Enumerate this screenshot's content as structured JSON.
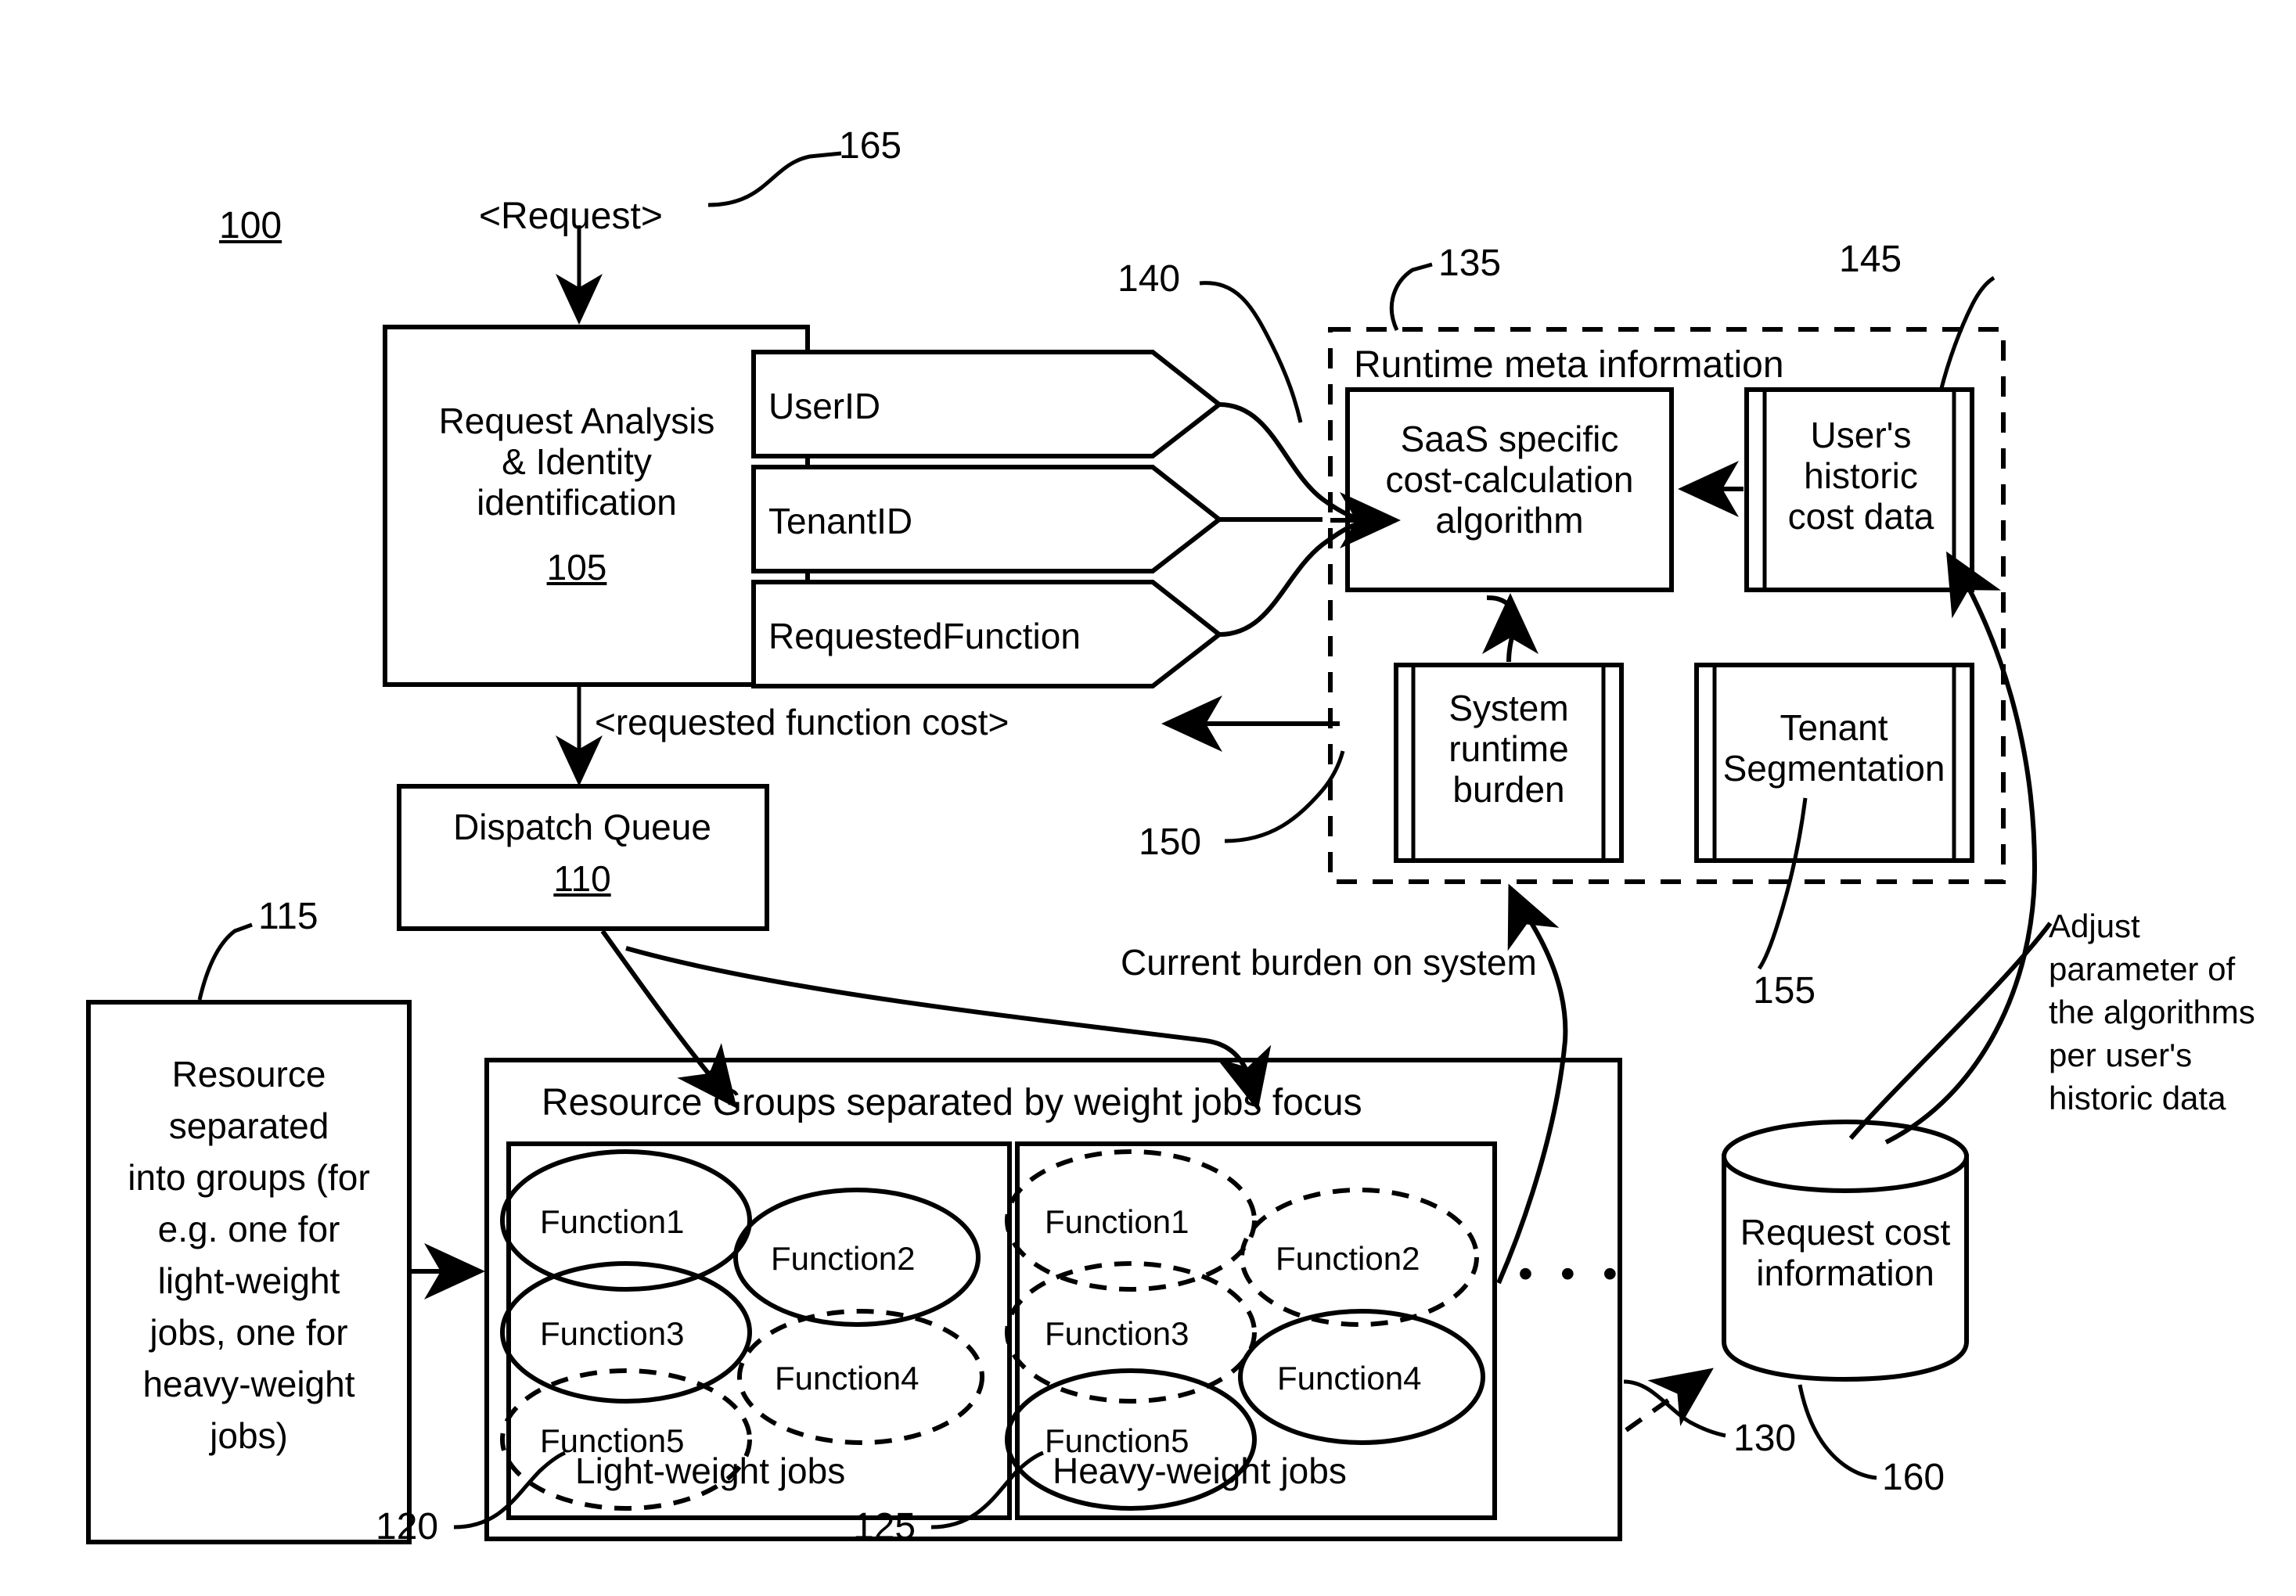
{
  "figure": {
    "figure_number": "100",
    "request_label": "<Request>",
    "request_ref": "165",
    "requested_function_cost_label": "<requested function cost>"
  },
  "request_analysis": {
    "line1": "Request Analysis",
    "line2": "& Identity",
    "line3": "identification",
    "ref": "105",
    "flags": [
      {
        "label": "UserID"
      },
      {
        "label": "TenantID"
      },
      {
        "label": "RequestedFunction"
      }
    ],
    "flags_ref": "140"
  },
  "dispatch_queue": {
    "title": "Dispatch Queue",
    "ref": "110"
  },
  "resource_note": {
    "text": "Resource separated into groups (for e.g. one for light-weight jobs, one for heavy-weight jobs)",
    "lines": [
      "Resource",
      "separated",
      "into groups (for",
      "e.g. one for",
      "light-weight",
      "jobs, one for",
      "heavy-weight",
      "jobs)"
    ],
    "ref": "115"
  },
  "runtime_meta": {
    "title": "Runtime meta information",
    "ref": "135",
    "saas": {
      "line1": "SaaS specific",
      "line2": "cost-calculation",
      "line3": "algorithm"
    },
    "historic": {
      "line1": "User's",
      "line2": "historic",
      "line3": "cost data",
      "ref": "145"
    },
    "burden": {
      "line1": "System",
      "line2": "runtime",
      "line3": "burden",
      "ref": "150"
    },
    "tenant": {
      "line1": "Tenant",
      "line2": "Segmentation",
      "ref": "155"
    }
  },
  "annotations": {
    "current_burden": "Current burden on system",
    "adjust_parameter_lines": [
      "Adjust",
      "parameter of",
      "the algorithms",
      "per user's",
      "historic data"
    ]
  },
  "resource_groups": {
    "title": "Resource Groups separated by weight jobs focus",
    "ref": "130",
    "ellipsis": "• • •",
    "groups": [
      {
        "name": "Light-weight jobs",
        "ref": "120",
        "functions": [
          {
            "label": "Function1",
            "style": "solid"
          },
          {
            "label": "Function2",
            "style": "solid"
          },
          {
            "label": "Function3",
            "style": "solid"
          },
          {
            "label": "Function4",
            "style": "dashed"
          },
          {
            "label": "Function5",
            "style": "dashed"
          }
        ]
      },
      {
        "name": "Heavy-weight jobs",
        "ref": "125",
        "functions": [
          {
            "label": "Function1",
            "style": "dashed"
          },
          {
            "label": "Function2",
            "style": "dashed"
          },
          {
            "label": "Function3",
            "style": "dashed"
          },
          {
            "label": "Function4",
            "style": "solid"
          },
          {
            "label": "Function5",
            "style": "solid"
          }
        ]
      }
    ]
  },
  "request_cost_store": {
    "line1": "Request cost",
    "line2": "information",
    "ref": "160"
  },
  "colors": {
    "stroke": "#000000",
    "background": "#ffffff"
  }
}
